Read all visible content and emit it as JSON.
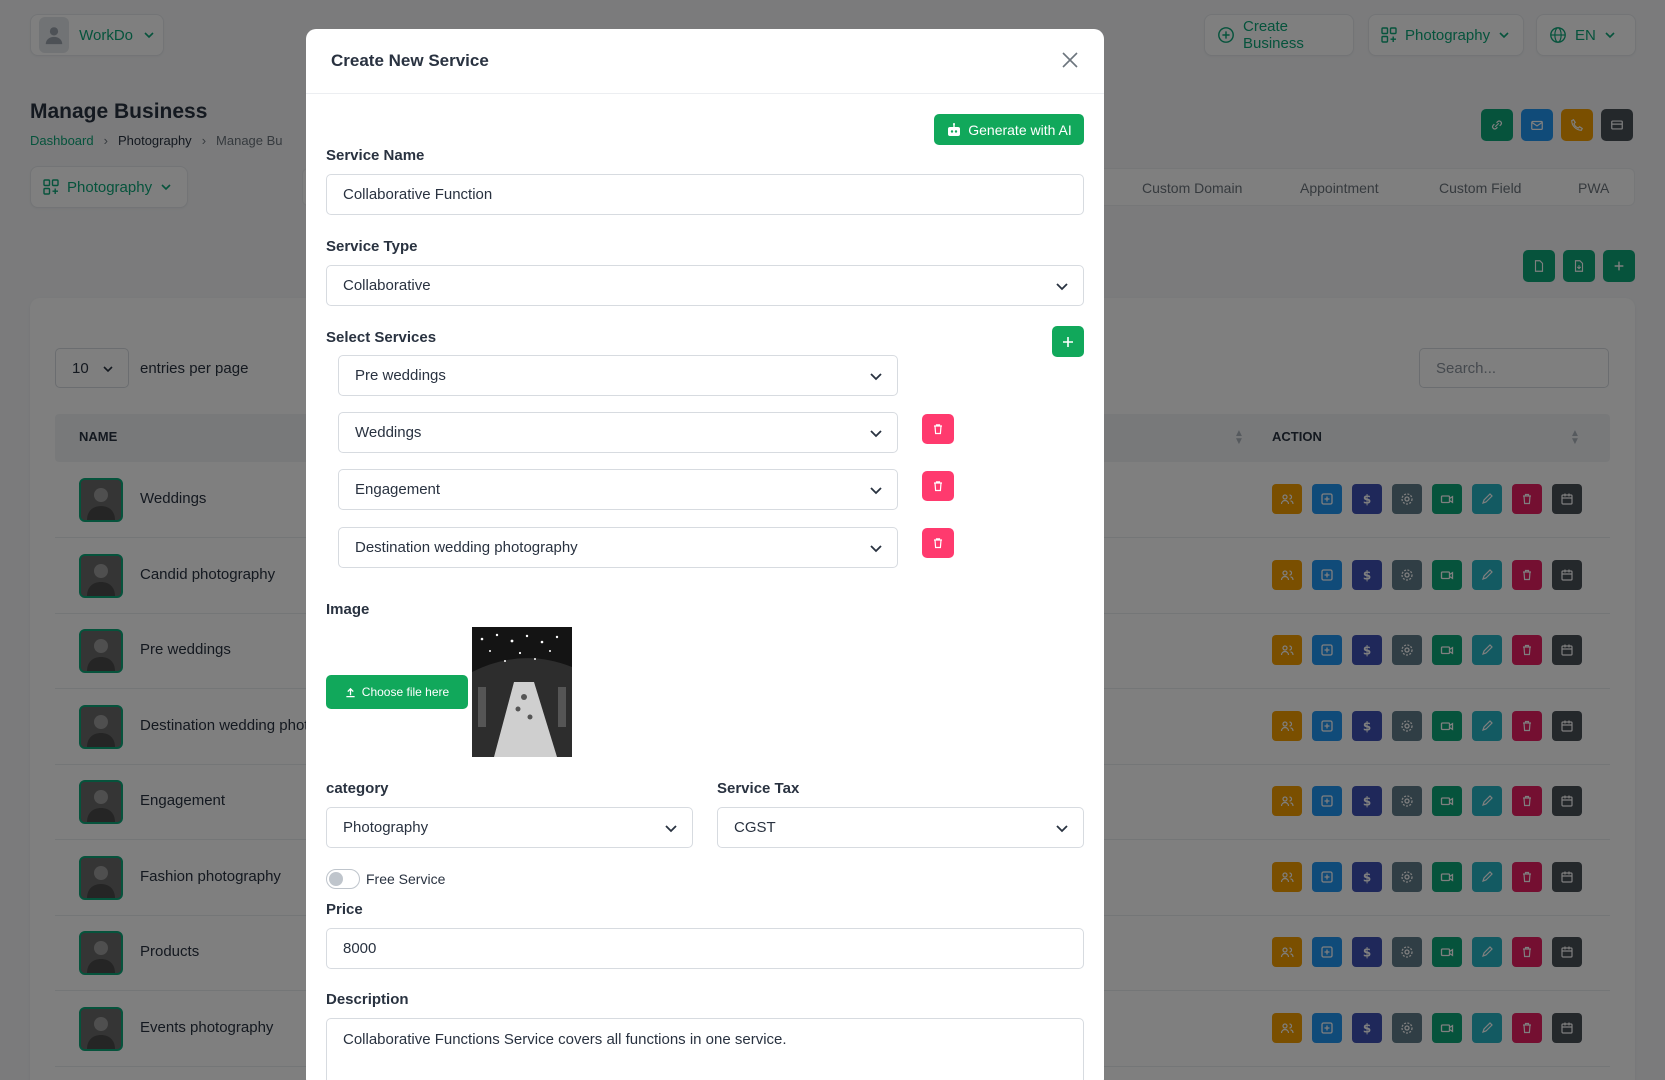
{
  "topbar": {
    "workspace": "WorkDo",
    "create_business": "Create Business",
    "business_select": "Photography",
    "language": "EN"
  },
  "page": {
    "title": "Manage Business",
    "breadcrumb": [
      "Dashboard",
      "Photography",
      "Manage Bu"
    ],
    "business_chip": "Photography",
    "tabs": [
      "Custom Domain",
      "Appointment",
      "Custom Field",
      "PWA"
    ]
  },
  "table": {
    "entries_value": "10",
    "entries_label": "entries per page",
    "search_placeholder": "Search...",
    "col_name": "NAME",
    "col_action": "ACTION",
    "rows": [
      "Weddings",
      "Candid photography",
      "Pre weddings",
      "Destination wedding phot",
      "Engagement",
      "Fashion photography",
      "Products",
      "Events photography"
    ]
  },
  "modal": {
    "title": "Create New Service",
    "generate_ai": "Generate with AI",
    "service_name_label": "Service Name",
    "service_name_value": "Collaborative Function",
    "service_type_label": "Service Type",
    "service_type_value": "Collaborative",
    "select_services_label": "Select Services",
    "services": [
      "Pre weddings",
      "Weddings",
      "Engagement",
      "Destination wedding photography"
    ],
    "image_label": "Image",
    "choose_file": "Choose file here",
    "category_label": "category",
    "category_value": "Photography",
    "tax_label": "Service Tax",
    "tax_value": "CGST",
    "free_service_label": "Free Service",
    "free_service_on": false,
    "price_label": "Price",
    "price_value": "8000",
    "description_label": "Description",
    "description_value": "Collaborative Functions Service covers all functions in one service."
  },
  "colors": {
    "primary": "#0ca678",
    "accent_green": "#11a85b",
    "danger": "#ff3a6e"
  }
}
